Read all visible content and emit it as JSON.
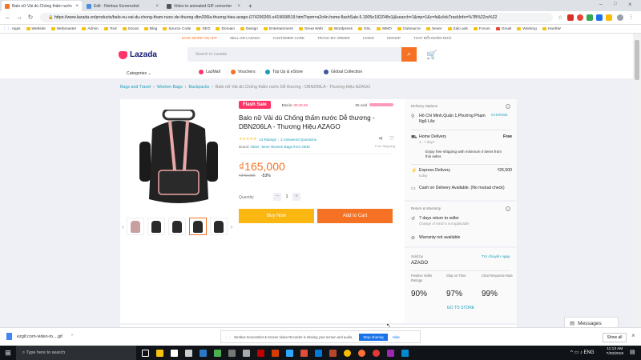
{
  "browser": {
    "tabs": [
      {
        "title": "Balo nữ Vải dù Chống thấm nước",
        "active": true,
        "color": "#f57224"
      },
      {
        "title": "Edit - Nimbus Screenshot",
        "active": false,
        "color": "#4a90e2"
      },
      {
        "title": "Video to animated GIF converter",
        "active": false,
        "color": "#555555"
      }
    ],
    "url": "https://www.lazada.vn/products/balo-nu-vai-du-chong-tham-nuoc-de-thuong-dbn206la-thuong-hieu-azago-i274290265-s419668519.html?spm=a2o4n.home.flashSale.6.1905e182Z48n1j&search=1&mp=1&c=fs&clickTrackInfo=%7B%22rs%22",
    "bookmarks": [
      "Apps",
      "Website",
      "Webmaster",
      "Admin",
      "Tool",
      "Social",
      "Blog",
      "Source Code",
      "SEO",
      "Domain",
      "Design",
      "Entertainment",
      "Great Web",
      "Wordpress",
      "SSL",
      "MMO",
      "Outsource",
      "Sever",
      "Zalo ads",
      "Forum",
      "Gmail",
      "Working",
      "HanhW"
    ]
  },
  "topbar": [
    "SAVE MORE ON APP",
    "SELL ON LAZADA",
    "CUSTOMER CARE",
    "TRACK MY ORDER",
    "LOGIN",
    "SIGNUP",
    "THAY ĐỔI NGÔN NGỮ"
  ],
  "header": {
    "logo": "Lazada",
    "search_placeholder": "Search in Lazada",
    "categories": "Categories",
    "nav": [
      {
        "label": "LazMall",
        "color": "#f36"
      },
      {
        "label": "Vouchers",
        "color": "#f57224"
      },
      {
        "label": "Top Up & eStore",
        "color": "#1a9cb7"
      },
      {
        "label": "Global Collection",
        "color": "#3b5998"
      }
    ]
  },
  "breadcrumb": [
    "Bags and Travel",
    "Women Bags",
    "Backpacks",
    "Balo nữ Vải dù Chống thấm nước Dễ thương - DBN206LA - Thương Hiệu AZAGO"
  ],
  "product": {
    "flash_tag": "Flash Sale",
    "ends_in_label": "End in",
    "ends_in_time": "00:46:40",
    "sold": "85 sold",
    "title": "Balo nữ Vải dù Chống thấm nước Dễ thương - DBN206LA - Thương Hiệu AZAGO",
    "stars": "★★★★★",
    "ratings": "13 Ratings",
    "sep": "|",
    "questions": "2 Answered Questions",
    "brand_label": "Brand:",
    "brand": "OEM",
    "brand_more": "More Women Bags from OEM",
    "free_shipping": "Free Shipping",
    "price": "₫165,000",
    "old_price": "₫349,000",
    "discount": "-53%",
    "quantity_label": "Quantity",
    "quantity": "1",
    "buy_now": "Buy Now",
    "add_to_cart": "Add to Cart"
  },
  "delivery": {
    "title": "Delivery Options",
    "address": "Hồ Chí Minh,Quận 1,Phường Phạm Ngũ Lão",
    "change": "CHANGE",
    "home": "Home Delivery",
    "home_days": "4 - 7 days",
    "home_price": "Free",
    "home_note": "Enjoy free shipping with minimum 0 items from this seller.",
    "express": "Express Delivery",
    "express_days": "today",
    "express_price": "₫26,500",
    "cod": "Cash on Delivery Available. (No mutual check)"
  },
  "returns": {
    "title": "Return & Warranty",
    "return": "7 days return to seller",
    "return_note": "Change of mind is not applicable",
    "warranty": "Warranty not available"
  },
  "seller": {
    "label": "Sold by",
    "name": "AZAGO",
    "chat": "Trò chuyện ngay",
    "stats": [
      {
        "label": "Positive Seller Ratings",
        "value": "90%"
      },
      {
        "label": "Ship on Time",
        "value": "97%"
      },
      {
        "label": "Chat Response Rate",
        "value": "99%"
      }
    ],
    "go_store": "GO TO STORE"
  },
  "messages": "Messages",
  "downloads": {
    "file": "ezgif.com-video-to....gif",
    "show_all": "Show all"
  },
  "sharebar": {
    "text": "Nimbus Screenshot & Screen Video Recorder is sharing your screen and audio.",
    "stop": "Stop sharing",
    "hide": "Hide"
  },
  "taskbar": {
    "search": "Type here to search",
    "time": "11:13 AM",
    "date": "7/20/2019"
  }
}
